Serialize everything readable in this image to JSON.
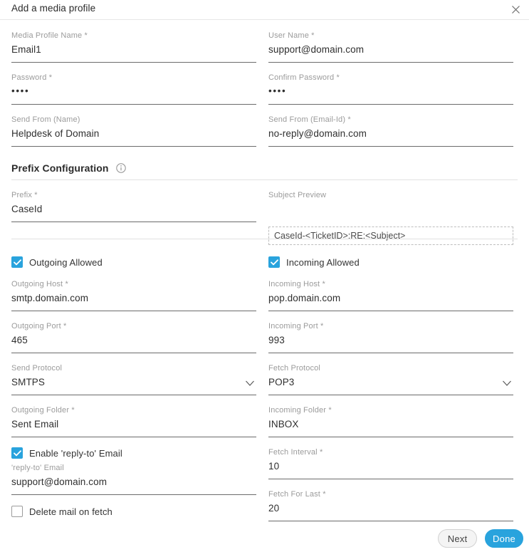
{
  "dialog": {
    "title": "Add a media profile",
    "close_icon": "close-icon"
  },
  "fields": {
    "media_profile_name": {
      "label": "Media Profile Name *",
      "value": "Email1"
    },
    "user_name": {
      "label": "User Name *",
      "value": "support@domain.com"
    },
    "password": {
      "label": "Password *",
      "value": "••••"
    },
    "confirm_password": {
      "label": "Confirm Password *",
      "value": "••••"
    },
    "send_from_name": {
      "label": "Send From (Name)",
      "value": "Helpdesk of Domain"
    },
    "send_from_email": {
      "label": "Send From (Email-Id) *",
      "value": "no-reply@domain.com"
    },
    "prefix": {
      "label": "Prefix *",
      "value": "CaseId"
    },
    "subject_preview": {
      "label": "Subject Preview",
      "value": "CaseId-<TicketID>:RE:<Subject>"
    },
    "outgoing_host": {
      "label": "Outgoing Host *",
      "value": "smtp.domain.com"
    },
    "incoming_host": {
      "label": "Incoming Host *",
      "value": "pop.domain.com"
    },
    "outgoing_port": {
      "label": "Outgoing Port *",
      "value": "465"
    },
    "incoming_port": {
      "label": "Incoming Port *",
      "value": "993"
    },
    "send_protocol": {
      "label": "Send Protocol",
      "value": "SMTPS"
    },
    "fetch_protocol": {
      "label": "Fetch Protocol",
      "value": "POP3"
    },
    "outgoing_folder": {
      "label": "Outgoing Folder *",
      "value": "Sent Email"
    },
    "incoming_folder": {
      "label": "Incoming Folder *",
      "value": "INBOX"
    },
    "reply_to_email": {
      "label": "'reply-to' Email",
      "value": "support@domain.com"
    },
    "fetch_interval": {
      "label": "Fetch Interval *",
      "value": "10"
    },
    "fetch_for_last": {
      "label": "Fetch For Last *",
      "value": "20"
    }
  },
  "sections": {
    "prefix_configuration": {
      "title": "Prefix Configuration",
      "info_icon": "info-icon"
    }
  },
  "checkboxes": {
    "outgoing_allowed": {
      "label": "Outgoing Allowed",
      "checked": true
    },
    "incoming_allowed": {
      "label": "Incoming Allowed",
      "checked": true
    },
    "enable_reply_to": {
      "label": "Enable 'reply-to' Email",
      "checked": true
    },
    "delete_mail_on_fetch": {
      "label": "Delete mail on fetch",
      "checked": false
    }
  },
  "footer": {
    "next_label": "Next",
    "done_label": "Done"
  },
  "colors": {
    "accent": "#29a3dd",
    "label": "#9b9b9b",
    "text": "#2f2f2f",
    "underline": "#6b6b6b",
    "divider": "#e2e2e2"
  }
}
